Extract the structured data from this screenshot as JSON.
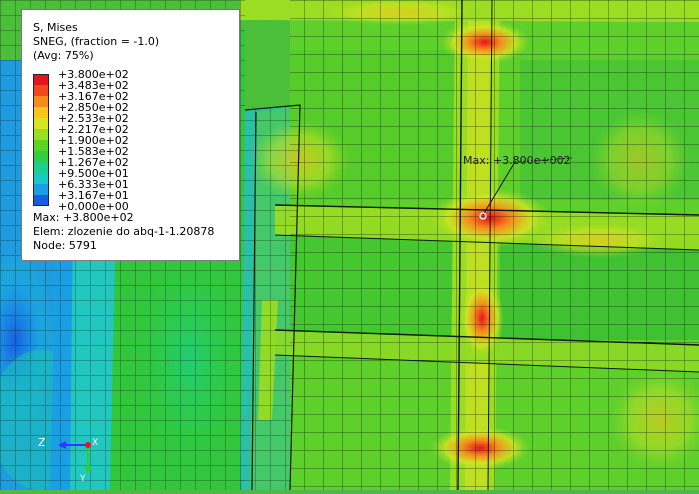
{
  "legend": {
    "title": "S, Mises",
    "subtitle": "SNEG, (fraction = -1.0)",
    "avg": "(Avg: 75%)",
    "levels": [
      {
        "value": "+3.800e+02",
        "color": "#e8141d"
      },
      {
        "value": "+3.483e+02",
        "color": "#f0481a"
      },
      {
        "value": "+3.167e+02",
        "color": "#f58b1b"
      },
      {
        "value": "+2.850e+02",
        "color": "#f7c51c"
      },
      {
        "value": "+2.533e+02",
        "color": "#d7e521"
      },
      {
        "value": "+2.217e+02",
        "color": "#9bdd22"
      },
      {
        "value": "+1.900e+02",
        "color": "#5cd424"
      },
      {
        "value": "+1.583e+02",
        "color": "#2ecf40"
      },
      {
        "value": "+1.267e+02",
        "color": "#1bd08c"
      },
      {
        "value": "+9.500e+01",
        "color": "#17c9c9"
      },
      {
        "value": "+6.333e+01",
        "color": "#1a9fe4"
      },
      {
        "value": "+3.167e+01",
        "color": "#175fe2"
      },
      {
        "value": "+0.000e+00",
        "color": "#1a20d4"
      }
    ],
    "max_line": "Max: +3.800e+02",
    "elem_line": "Elem: zlozenie do abq-1-1.20878",
    "node_line": "Node: 5791"
  },
  "viewport": {
    "max_annotation": "Max: +3.800e+002"
  },
  "triad": {
    "z_label": "Z",
    "y_label": "Y",
    "x_label": "X"
  }
}
